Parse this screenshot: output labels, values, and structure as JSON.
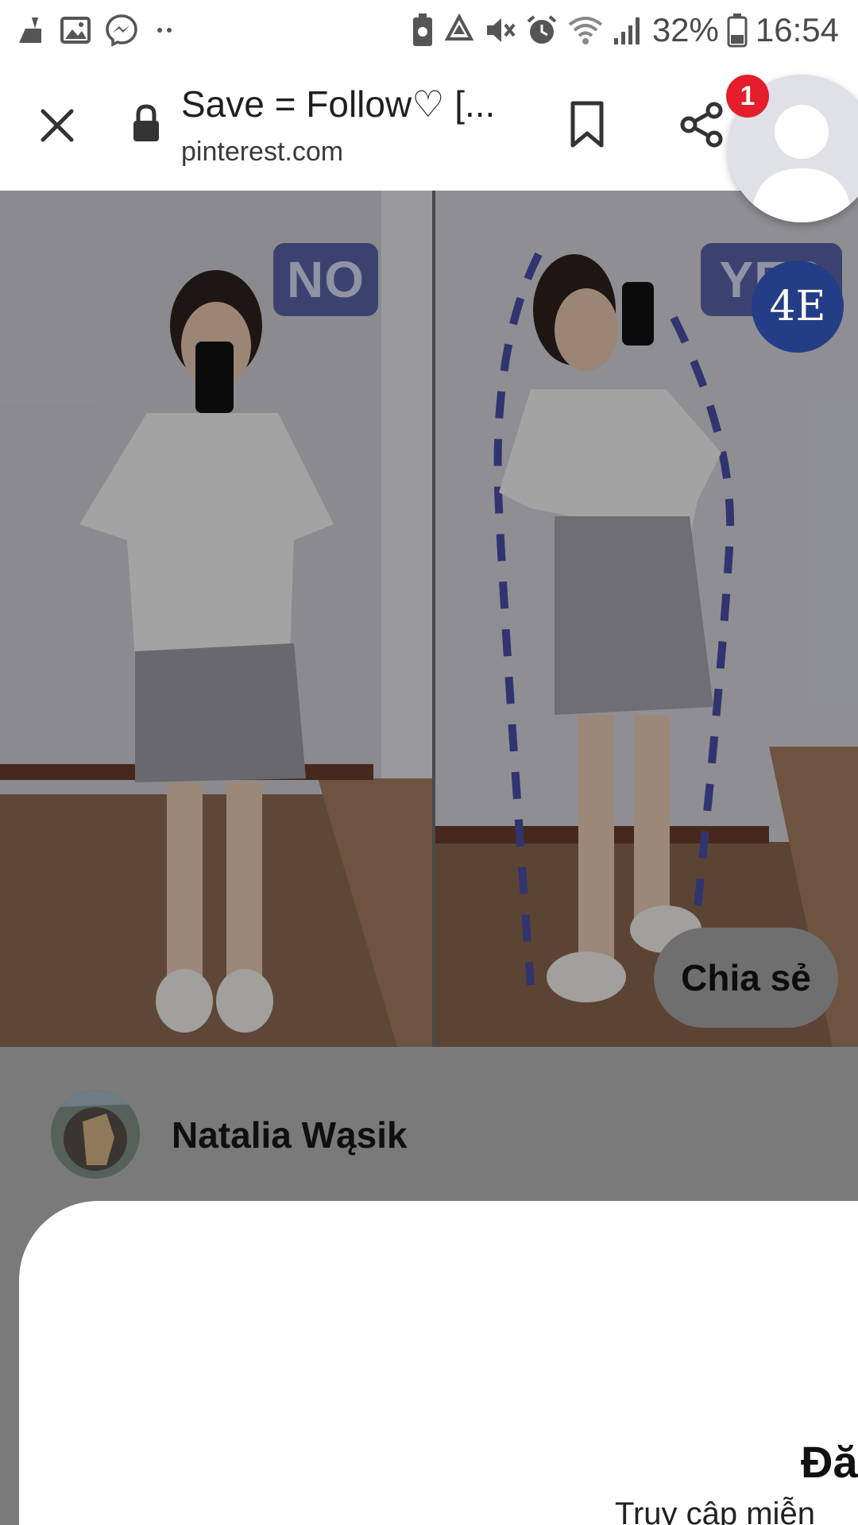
{
  "status_bar": {
    "battery_percent": "32%",
    "time": "16:54"
  },
  "browser": {
    "page_title": "Save = Follow♡ [...",
    "domain": "pinterest.com"
  },
  "chat_head": {
    "badge_count": "1"
  },
  "pin": {
    "label_left": "NO",
    "label_right": "YES",
    "logo_text": "4E",
    "share_chip_label": "Chia sẻ"
  },
  "author": {
    "name": "Natalia Wąsik"
  },
  "bottom_sheet": {
    "heading": "Đă",
    "subtext": "Truy cập miễn"
  },
  "colors": {
    "notification_red": "#e41e2b",
    "badge_blue": "#5a63a7",
    "logo_blue": "#233d87",
    "overlay_gray": "#7a7a7a"
  },
  "icons": [
    "cleaner-icon",
    "gallery-icon",
    "messenger-icon",
    "more-dots-icon",
    "battery-saver-icon",
    "recycle-icon",
    "mute-icon",
    "alarm-icon",
    "wifi-icon",
    "signal-icon",
    "battery-icon",
    "close-icon",
    "lock-icon",
    "bookmark-icon",
    "share-icon",
    "default-avatar-icon"
  ]
}
